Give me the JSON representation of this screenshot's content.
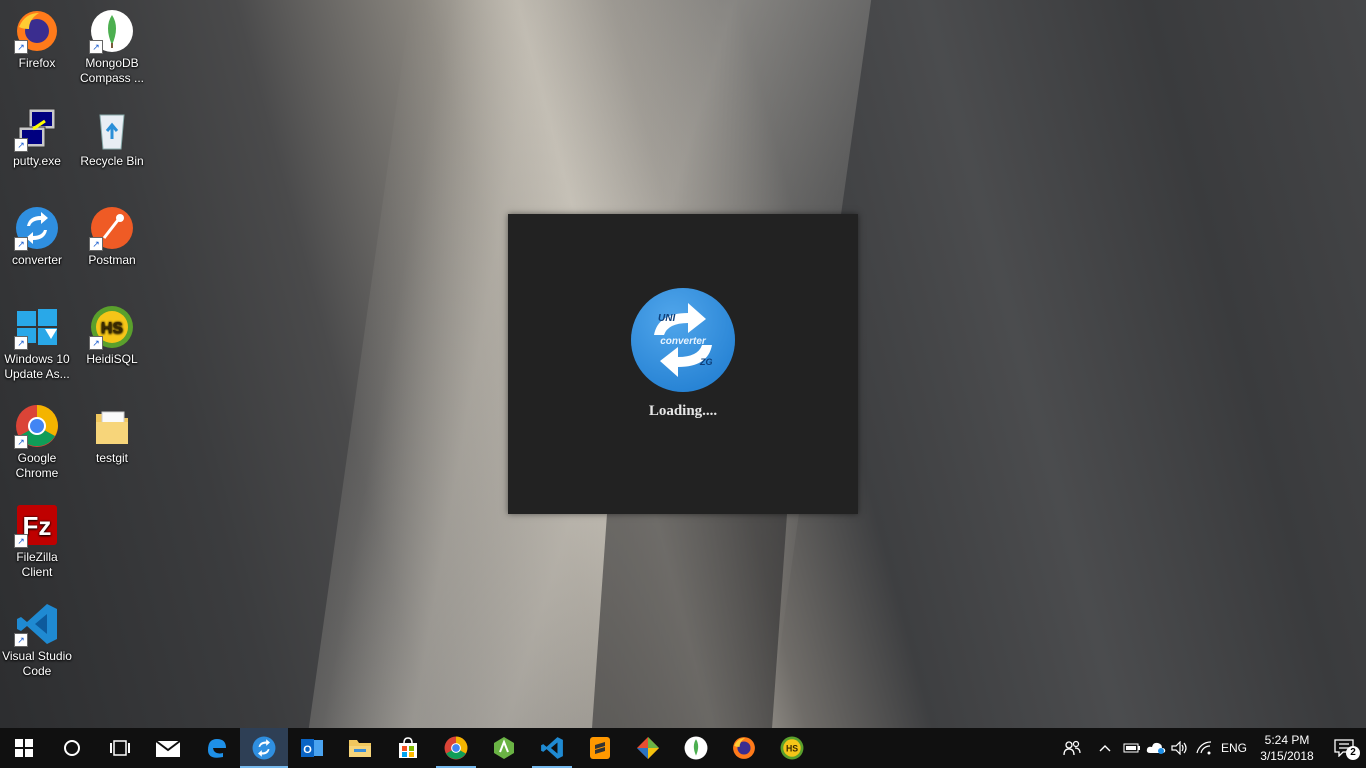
{
  "desktop": {
    "icons": [
      {
        "label": "Firefox",
        "icon": "firefox-icon"
      },
      {
        "label": "MongoDB Compass ...",
        "icon": "mongodb-icon"
      },
      {
        "label": "putty.exe",
        "icon": "putty-icon"
      },
      {
        "label": "Recycle Bin",
        "icon": "recycle-bin-icon"
      },
      {
        "label": "converter",
        "icon": "converter-icon"
      },
      {
        "label": "Postman",
        "icon": "postman-icon"
      },
      {
        "label": "Windows 10 Update As...",
        "icon": "windows-update-icon"
      },
      {
        "label": "HeidiSQL",
        "icon": "heidisql-icon"
      },
      {
        "label": "Google Chrome",
        "icon": "chrome-icon"
      },
      {
        "label": "testgit",
        "icon": "folder-icon"
      },
      {
        "label": "FileZilla Client",
        "icon": "filezilla-icon"
      },
      {
        "label": "Visual Studio Code",
        "icon": "vscode-icon"
      }
    ]
  },
  "splash": {
    "logo_text_top": "UNI",
    "logo_text_mid": "converter",
    "logo_text_bottom": "ZG",
    "status": "Loading....",
    "logo_color": "#2f8fe0",
    "background": "#222222"
  },
  "taskbar": {
    "apps": [
      "start",
      "cortana",
      "task-view",
      "mail",
      "edge",
      "converter",
      "outlook",
      "file-explorer",
      "store",
      "chrome",
      "android-studio",
      "vscode",
      "sublime",
      "git",
      "mongodb-compass",
      "firefox",
      "heidisql"
    ],
    "active_app": "converter",
    "lang": "ENG",
    "time": "5:24 PM",
    "date": "3/15/2018",
    "notifications": "2"
  },
  "colors": {
    "taskbar": "#101010",
    "accent": "#76b9ed"
  }
}
